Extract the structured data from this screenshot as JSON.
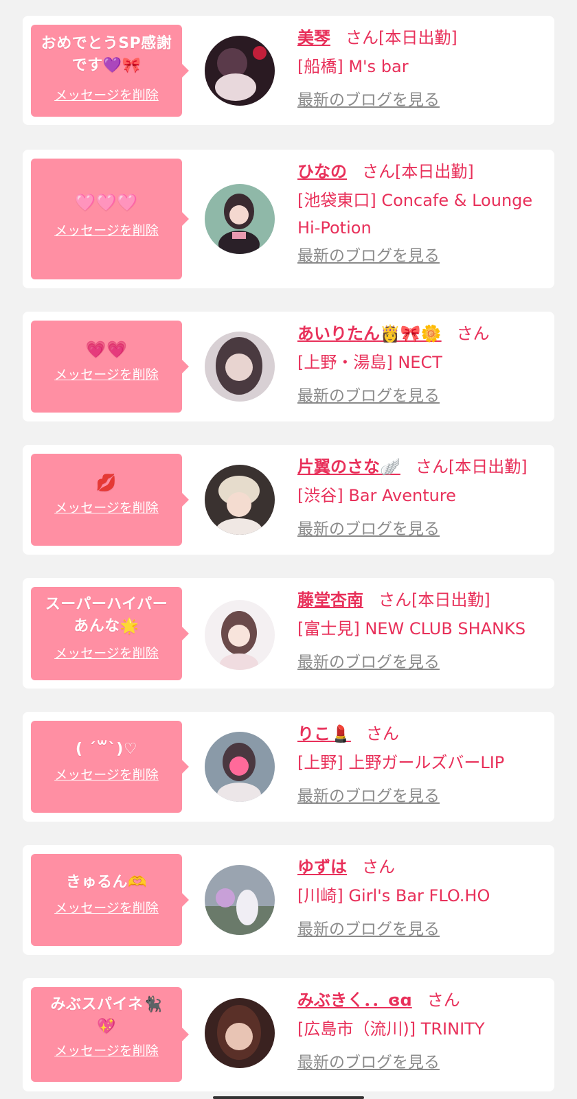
{
  "delete_label": "メッセージを削除",
  "blog_label": "最新のブログを見る",
  "colors": {
    "background": "#f2f2f2",
    "card": "#ffffff",
    "bubble": "#ff8fa3",
    "accent_text": "#e8305a",
    "blog_link": "#8a8a8a"
  },
  "entries": [
    {
      "message": "おめでとうSP感謝です💜🎀",
      "name": "美琴",
      "suffix": "さん[本日出勤]",
      "shop": "[船橋] M's bar"
    },
    {
      "message": "🩷🩷🩷",
      "name": "ひなの",
      "suffix": "さん[本日出勤]",
      "shop": "[池袋東口] Concafe & Lounge Hi-Potion"
    },
    {
      "message": "💗💗",
      "name": "あいりたん👸🎀🌼",
      "suffix": "さん",
      "shop": "[上野・湯島] NECT"
    },
    {
      "message": "💋",
      "name": "片翼のさな🪽",
      "suffix": "さん[本日出勤]",
      "shop": "[渋谷] Bar Aventure"
    },
    {
      "message": "スーパーハイパーあんな🌟",
      "name": "藤堂杏南",
      "suffix": "さん[本日出勤]",
      "shop": "[富士見] NEW CLUB SHANKS"
    },
    {
      "message": "( ´꒳`)♡",
      "name": "りこ💄",
      "suffix": "さん",
      "shop": "[上野] 上野ガールズバーLIP"
    },
    {
      "message": "きゅるん🫶",
      "name": "ゆずは",
      "suffix": "さん",
      "shop": "[川崎] Girl's Bar FLO.HO"
    },
    {
      "message": "みぶスパイネ🐈‍⬛💖",
      "name": "みぶきㄑ．．ɞɑ",
      "suffix": "さん",
      "shop": "[広島市（流川)] TRINITY"
    }
  ]
}
